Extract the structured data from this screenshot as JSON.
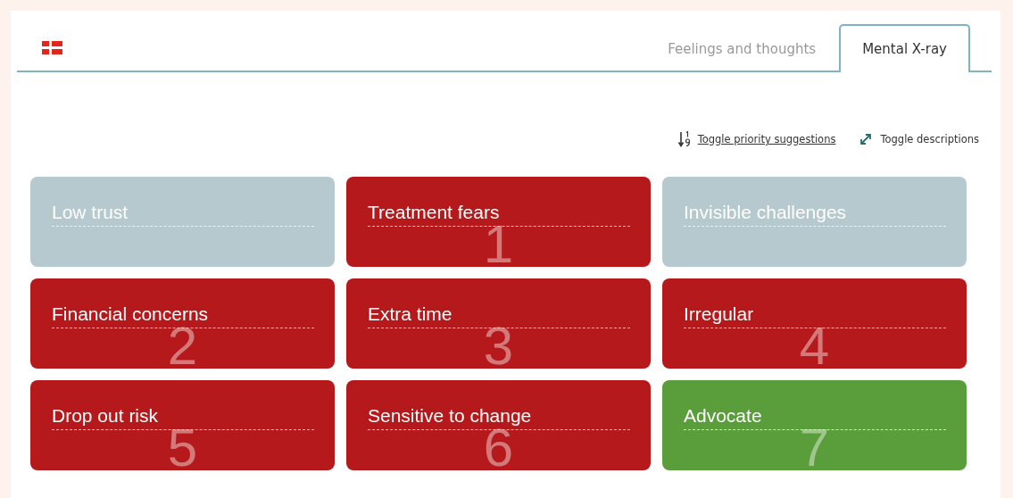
{
  "tabs": [
    {
      "label": "Feelings and thoughts",
      "selected": false
    },
    {
      "label": "Mental X-ray",
      "selected": true
    }
  ],
  "toolbar": [
    {
      "kind": "priority",
      "label": "Toggle priority suggestions"
    },
    {
      "kind": "descriptions",
      "label": "Toggle descriptions"
    }
  ],
  "cards": [
    {
      "title": "Low trust",
      "color": "#b5c9ce"
    },
    {
      "title": "Treatment fears",
      "priority": "1",
      "color": "#b5191b"
    },
    {
      "title": "Invisible challenges",
      "color": "#b5c9ce"
    },
    {
      "title": "Financial concerns",
      "priority": "2",
      "color": "#b5191b"
    },
    {
      "title": "Extra time",
      "priority": "3",
      "color": "#b5191b"
    },
    {
      "title": "Irregular",
      "priority": "4",
      "color": "#b5191b"
    },
    {
      "title": "Drop out risk",
      "priority": "5",
      "color": "#b5191b"
    },
    {
      "title": "Sensitive to change",
      "priority": "6",
      "color": "#b5191b"
    },
    {
      "title": "Advocate",
      "priority": "7",
      "color": "#5a9d3b"
    }
  ]
}
